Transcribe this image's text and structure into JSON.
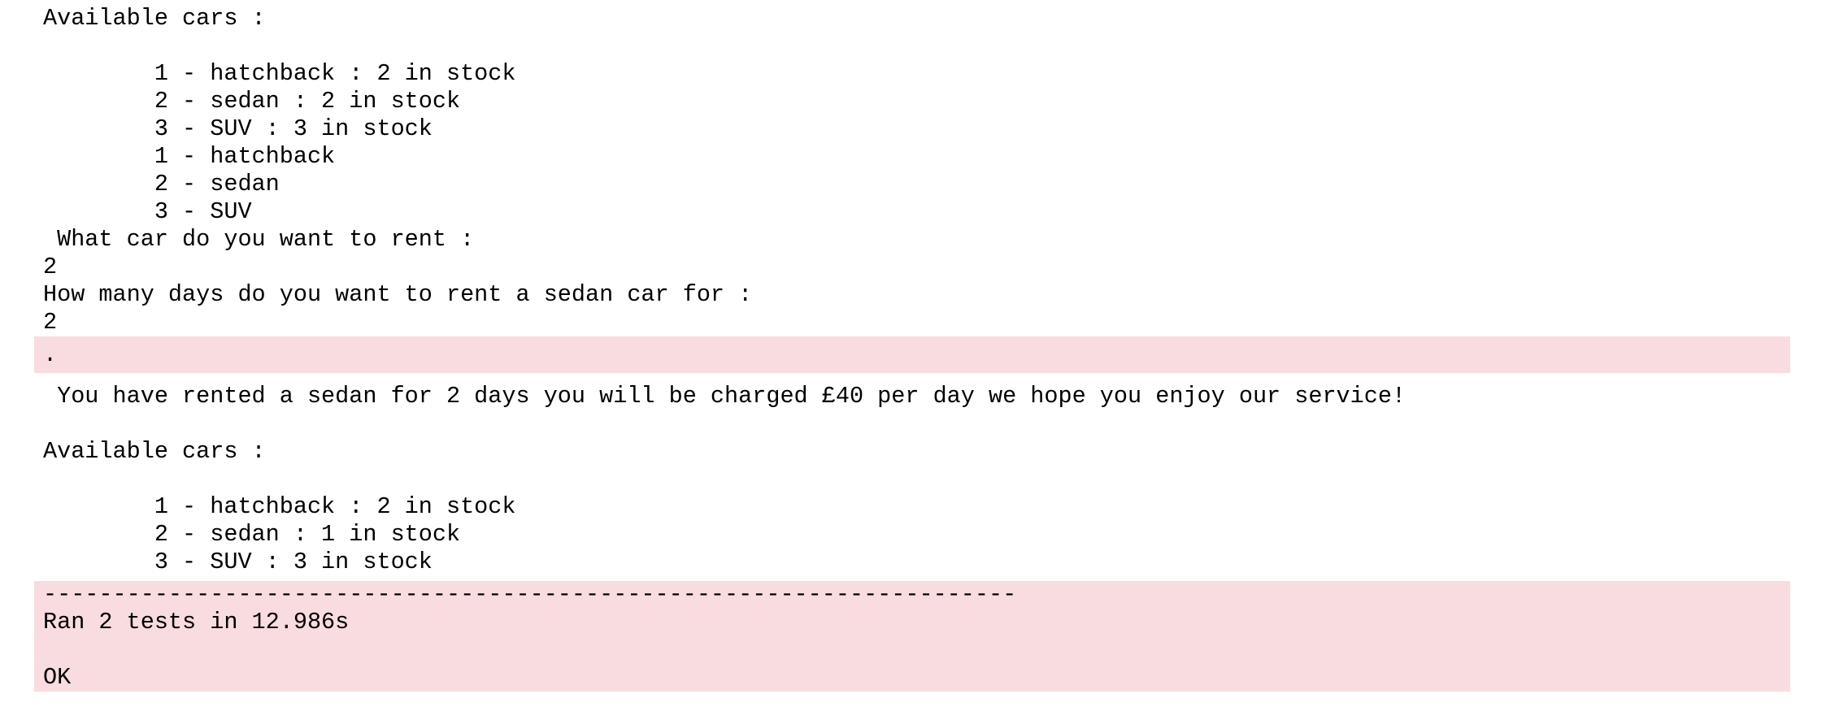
{
  "output": {
    "block1": "Available cars :\n\n        1 - hatchback : 2 in stock\n        2 - sedan : 2 in stock\n        3 - SUV : 3 in stock\n        1 - hatchback\n        2 - sedan\n        3 - SUV\n What car do you want to rent :\n2\nHow many days do you want to rent a sedan car for :\n2",
    "stderr_dot": ".",
    "block2": " You have rented a sedan for 2 days you will be charged £40 per day we hope you enjoy our service!\n\nAvailable cars :\n\n        1 - hatchback : 2 in stock\n        2 - sedan : 1 in stock\n        3 - SUV : 3 in stock",
    "stderr_summary": "----------------------------------------------------------------------\nRan 2 tests in 12.986s\n\nOK"
  },
  "colors": {
    "stderr_background": "#f9dcdf",
    "text": "#000000",
    "background": "#ffffff"
  }
}
